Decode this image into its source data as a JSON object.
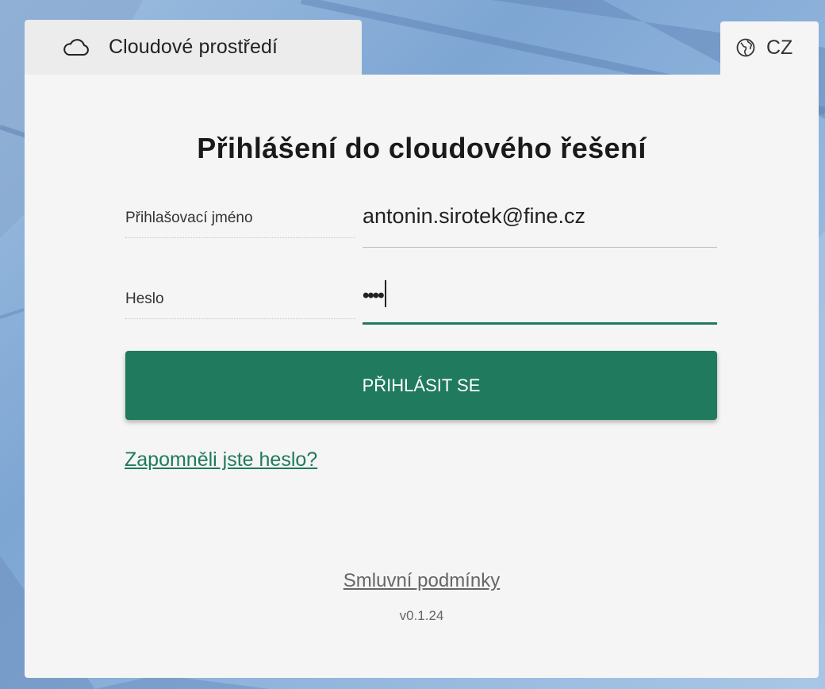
{
  "tab": {
    "label": "Cloudové prostředí",
    "icon": "cloud-icon"
  },
  "language": {
    "label": "CZ",
    "icon": "globe-icon"
  },
  "login": {
    "title": "Přihlášení do cloudového řešení",
    "username_label": "Přihlašovací jméno",
    "username_value": "antonin.sirotek@fine.cz",
    "password_label": "Heslo",
    "password_value": "••••",
    "submit_label": "PŘIHLÁSIT SE",
    "forgot_label": "Zapomněli jste heslo?"
  },
  "footer": {
    "terms_label": "Smluvní podmínky",
    "version": "v0.1.24"
  },
  "colors": {
    "accent": "#207a5e",
    "card": "#f5f5f5",
    "tab": "#ececec"
  }
}
